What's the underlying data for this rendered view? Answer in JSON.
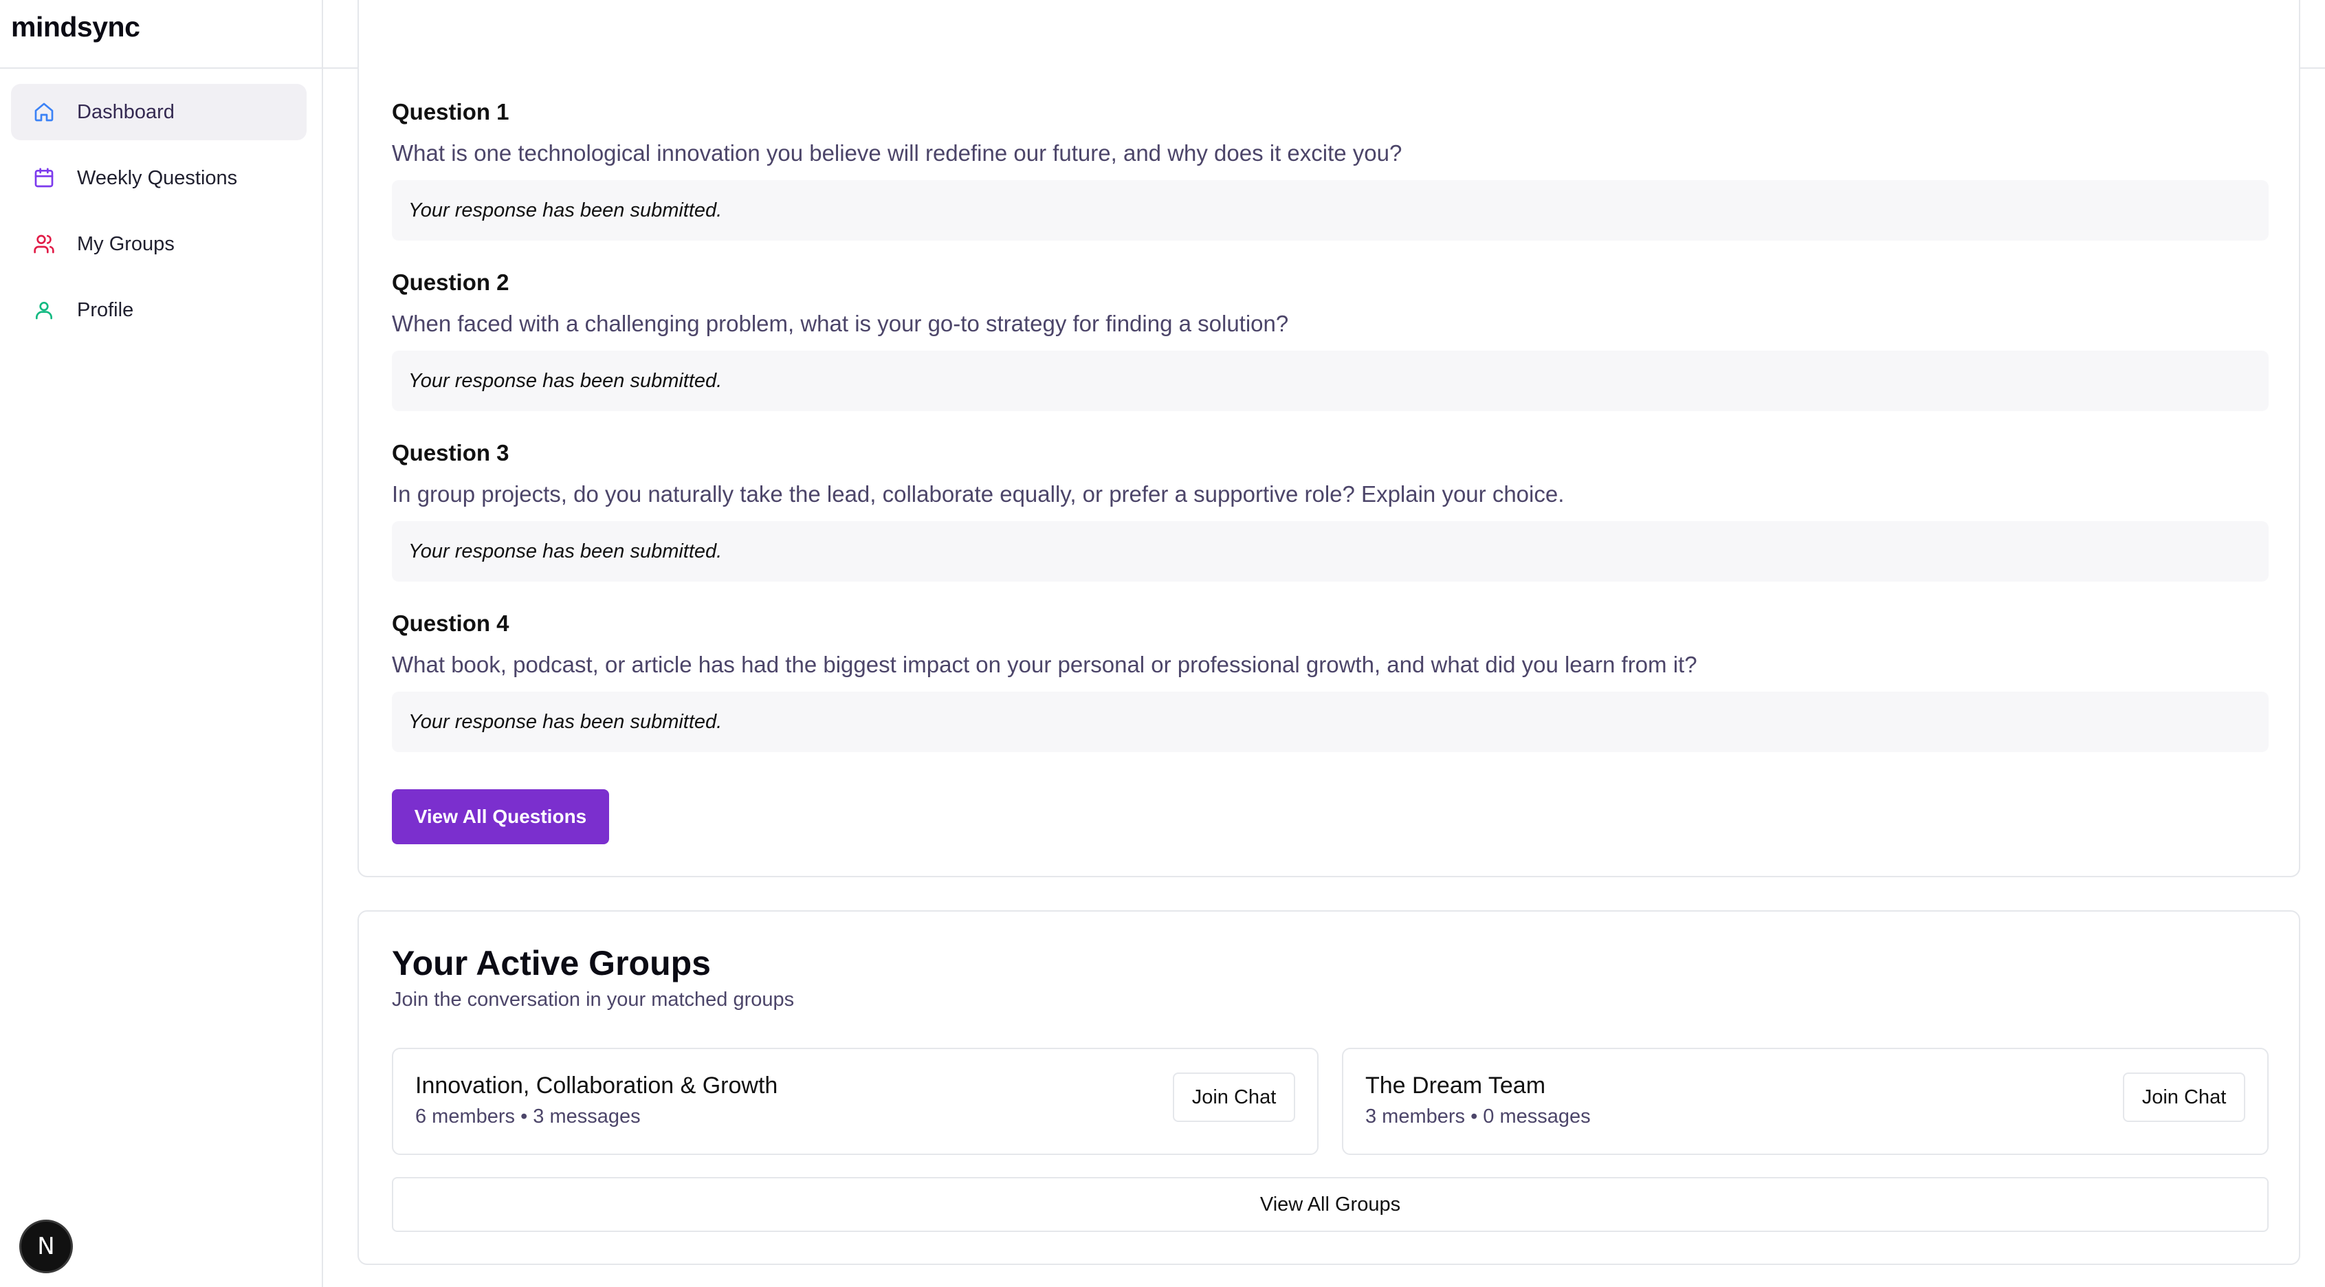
{
  "app": {
    "logo": "mindsync"
  },
  "sidebar": {
    "items": [
      {
        "label": "Dashboard",
        "icon": "home-icon",
        "color": "#3b82f6",
        "active": true
      },
      {
        "label": "Weekly Questions",
        "icon": "calendar-icon",
        "color": "#7c3aed"
      },
      {
        "label": "My Groups",
        "icon": "users-icon",
        "color": "#e11d48"
      },
      {
        "label": "Profile",
        "icon": "user-icon",
        "color": "#10b981"
      }
    ],
    "badge": "N"
  },
  "topbar": {
    "left_icon": "brain-icon",
    "theme_icon": "moon-icon",
    "avatar_icon": "avatar"
  },
  "questions": [
    {
      "title": "Question 1",
      "text": "What is one technological innovation you believe will redefine our future, and why does it excite you?",
      "response": "Your response has been submitted."
    },
    {
      "title": "Question 2",
      "text": "When faced with a challenging problem, what is your go-to strategy for finding a solution?",
      "response": "Your response has been submitted."
    },
    {
      "title": "Question 3",
      "text": "In group projects, do you naturally take the lead, collaborate equally, or prefer a supportive role? Explain your choice.",
      "response": "Your response has been submitted."
    },
    {
      "title": "Question 4",
      "text": "What book, podcast, or article has had the biggest impact on your personal or professional growth, and what did you learn from it?",
      "response": "Your response has been submitted."
    }
  ],
  "view_all_questions": "View All Questions",
  "groups": {
    "title": "Your Active Groups",
    "subtitle": "Join the conversation in your matched groups",
    "items": [
      {
        "name": "Innovation, Collaboration & Growth",
        "meta": "6 members • 3 messages",
        "action": "Join Chat"
      },
      {
        "name": "The Dream Team",
        "meta": "3 members • 0 messages",
        "action": "Join Chat"
      }
    ],
    "view_all": "View All Groups"
  },
  "colors": {
    "primary": "#7b2fce",
    "muted_text": "#4c4569",
    "active_nav_bg": "#f1f0f4"
  }
}
